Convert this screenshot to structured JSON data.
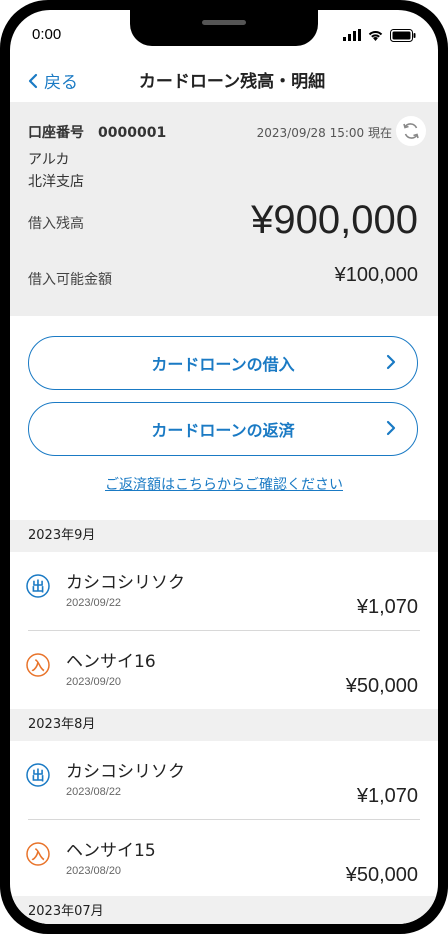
{
  "status_bar": {
    "time": "0:00"
  },
  "nav": {
    "back_label": "戻る",
    "title": "カードローン残高・明細"
  },
  "account": {
    "label": "口座番号",
    "number": "0000001",
    "as_of": "2023/09/28 15:00 現在",
    "bank_name": "アルカ",
    "branch_name": "北洋支店",
    "balance_label": "借入残高",
    "balance_value": "¥900,000",
    "available_label": "借入可能金額",
    "available_value": "¥100,000"
  },
  "actions": {
    "borrow_label": "カードローンの借入",
    "repay_label": "カードローンの返済",
    "help_link": "ご返済額はこちらからご確認ください"
  },
  "sections": [
    {
      "month": "2023年9月",
      "items": [
        {
          "type_label": "出",
          "type": "out",
          "name": "カシコシリソク",
          "date": "2023/09/22",
          "amount": "¥1,070"
        },
        {
          "type_label": "入",
          "type": "in",
          "name": "ヘンサイ16",
          "date": "2023/09/20",
          "amount": "¥50,000"
        }
      ]
    },
    {
      "month": "2023年8月",
      "items": [
        {
          "type_label": "出",
          "type": "out",
          "name": "カシコシリソク",
          "date": "2023/08/22",
          "amount": "¥1,070"
        },
        {
          "type_label": "入",
          "type": "in",
          "name": "ヘンサイ15",
          "date": "2023/08/20",
          "amount": "¥50,000"
        }
      ]
    },
    {
      "month": "2023年07月",
      "items": []
    }
  ],
  "colors": {
    "accent": "#1a7ac4",
    "out_badge": "#1a7ac4",
    "in_badge": "#e8732a",
    "summary_bg": "#eeeeee"
  },
  "icons": [
    "chevron-left-icon",
    "refresh-icon",
    "chevron-right-icon",
    "signal-icon",
    "wifi-icon",
    "battery-icon"
  ]
}
